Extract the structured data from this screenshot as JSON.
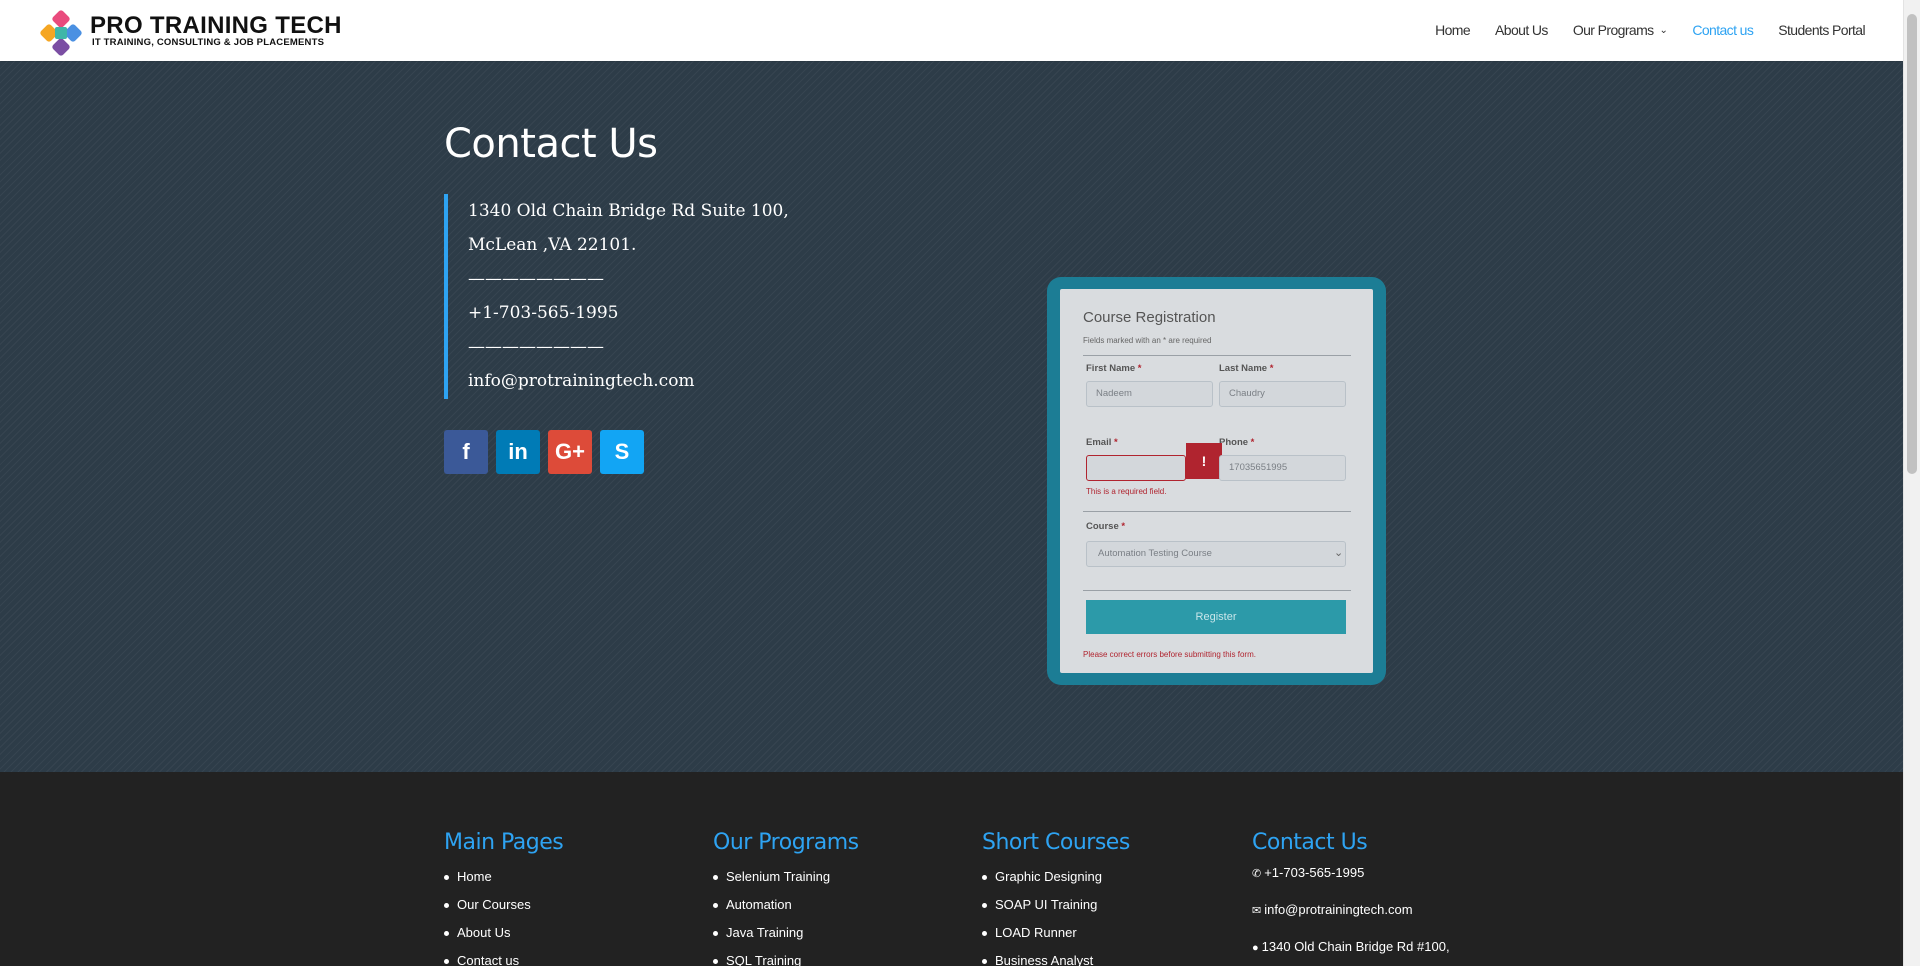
{
  "header": {
    "brand_title": "PRO TRAINING TECH",
    "brand_subtitle": "IT TRAINING, CONSULTING & JOB PLACEMENTS",
    "nav": [
      {
        "label": "Home"
      },
      {
        "label": "About Us"
      },
      {
        "label": "Our Programs"
      },
      {
        "label": "Contact us"
      },
      {
        "label": "Students Portal"
      }
    ]
  },
  "contact": {
    "title": "Contact Us",
    "address_line1": "1340 Old Chain Bridge Rd Suite 100,",
    "address_line2": "McLean ,VA  22101.",
    "divider1": "————————",
    "phone": "+1-703-565-1995",
    "divider2": "————————",
    "email": "info@protrainingtech.com"
  },
  "social": {
    "facebook_glyph": "f",
    "linkedin_glyph": "in",
    "googleplus_glyph": "G+",
    "skype_glyph": "S"
  },
  "form": {
    "title": "Course Registration",
    "note": "Fields marked with an * are required",
    "first_name_label": "First Name",
    "last_name_label": "Last Name",
    "email_label": "Email",
    "phone_label": "Phone",
    "course_label": "Course",
    "required_mark": "*",
    "first_name_value": "Nadeem",
    "last_name_value": "Chaudry",
    "email_value": "",
    "phone_value": "17035651995",
    "course_value": "Automation Testing Course",
    "error_icon": "!",
    "email_error": "This is a required field.",
    "register_label": "Register",
    "form_error": "Please correct errors before submitting this form."
  },
  "footer": {
    "main_pages": {
      "heading": "Main Pages",
      "items": [
        "Home",
        "Our Courses",
        "About Us",
        "Contact us"
      ]
    },
    "our_programs": {
      "heading": "Our Programs",
      "items": [
        "Selenium Training",
        "Automation",
        "Java Training",
        "SQL Training"
      ]
    },
    "short_courses": {
      "heading": "Short Courses",
      "items": [
        "Graphic Designing",
        "SOAP UI Training",
        "LOAD Runner",
        "Business Analyst"
      ]
    },
    "contact_us": {
      "heading": "Contact Us",
      "phone": "+1-703-565-1995",
      "email": "info@protrainingtech.com",
      "address": "1340 Old Chain Bridge Rd #100,"
    }
  },
  "colors": {
    "accent": "#2ea3f2",
    "hero_bg": "#2d3c48",
    "footer_bg": "#222222",
    "form_frame": "#1c7d95",
    "error": "#b0242f"
  }
}
